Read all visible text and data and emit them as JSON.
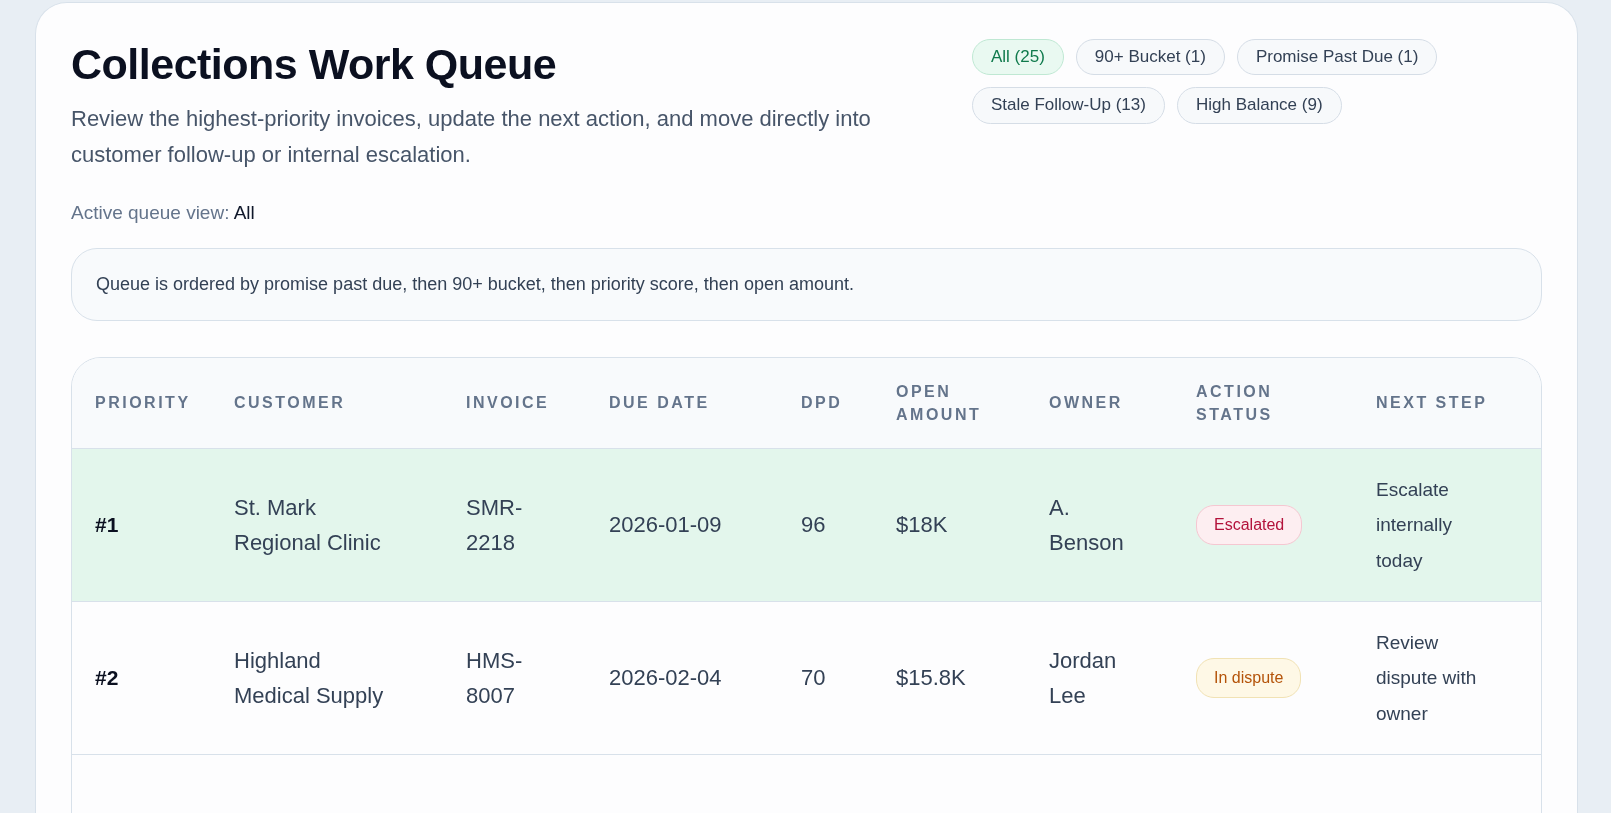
{
  "header": {
    "title": "Collections Work Queue",
    "description": "Review the highest-priority invoices, update the next action, and move directly into customer follow-up or internal escalation.",
    "active_view_label": "Active queue view:",
    "active_view_value": "All"
  },
  "filters": [
    {
      "label": "All (25)",
      "selected": true
    },
    {
      "label": "90+ Bucket (1)",
      "selected": false
    },
    {
      "label": "Promise Past Due (1)",
      "selected": false
    },
    {
      "label": "Stale Follow-Up (13)",
      "selected": false
    },
    {
      "label": "High Balance (9)",
      "selected": false
    }
  ],
  "notice": "Queue is ordered by promise past due, then 90+ bucket, then priority score, then open amount.",
  "table": {
    "columns": [
      "PRIORITY",
      "CUSTOMER",
      "INVOICE",
      "DUE DATE",
      "DPD",
      "OPEN AMOUNT",
      "OWNER",
      "ACTION STATUS",
      "NEXT STEP"
    ],
    "rows": [
      {
        "selected": true,
        "priority": "#1",
        "customer": "St. Mark Regional Clinic",
        "invoice": "SMR-2218",
        "due_date": "2026-01-09",
        "dpd": "96",
        "open_amount": "$18K",
        "owner": "A. Benson",
        "status": {
          "label": "Escalated",
          "kind": "escalated"
        },
        "next_step": "Escalate internally today"
      },
      {
        "selected": false,
        "priority": "#2",
        "customer": "Highland Medical Supply",
        "invoice": "HMS-8007",
        "due_date": "2026-02-04",
        "dpd": "70",
        "open_amount": "$15.8K",
        "owner": "Jordan Lee",
        "status": {
          "label": "In dispute",
          "kind": "dispute"
        },
        "next_step": "Review dispute with owner"
      }
    ]
  }
}
